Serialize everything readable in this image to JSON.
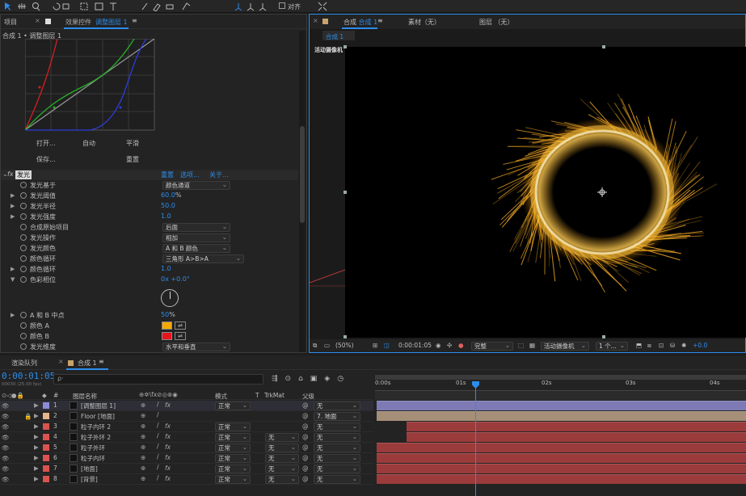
{
  "toolbar": {
    "align_label": "对齐"
  },
  "left_panel": {
    "tabs": [
      "项目",
      "效果控件",
      "调整图层 1"
    ],
    "tab_prefix": "效果控件",
    "tab_active": "调整图层 1",
    "breadcrumb": "合成 1 • 调整图层 1",
    "curve_buttons": {
      "open": "打开...",
      "auto": "自动",
      "smooth": "平滑",
      "save": "保存...",
      "reset": "重置"
    },
    "effect": {
      "fx": "fx",
      "name": "发光",
      "reset": "重置",
      "options": "选项...",
      "about": "关于..."
    },
    "props": [
      {
        "name": "发光基于",
        "dd": "颜色通道"
      },
      {
        "name": "发光阈值",
        "val": "60.0",
        "unit": "%"
      },
      {
        "name": "发光半径",
        "val": "50.0"
      },
      {
        "name": "发光强度",
        "val": "1.0"
      },
      {
        "name": "合成原始项目",
        "dd": "后面"
      },
      {
        "name": "发光操作",
        "dd": "相加"
      },
      {
        "name": "发光颜色",
        "dd": "A 和 B 颜色"
      },
      {
        "name": "颜色循环",
        "dd": "三角形 A>B>A"
      },
      {
        "name": "颜色循环",
        "val": "1.0"
      },
      {
        "name": "色彩相位",
        "val": "0x +0.0°"
      }
    ],
    "props2": [
      {
        "name": "A 和 B 中点",
        "val": "50",
        "unit": "%"
      },
      {
        "name": "颜色 A",
        "color": "#f5a800"
      },
      {
        "name": "颜色 B",
        "color": "#e8141c"
      },
      {
        "name": "发光维度",
        "dd": "水平和垂直"
      }
    ]
  },
  "viewer": {
    "tabs": [
      {
        "label": "合成",
        "active": "合成 1"
      },
      {
        "label": "素材（无）"
      },
      {
        "label": "图层 （无）"
      }
    ],
    "subtab": "合成 1",
    "camera_label": "活动摄像机",
    "bottom": {
      "zoom": "(50%)",
      "time": "0:00:01:05",
      "quality": "完整",
      "camera": "活动摄像机",
      "views": "1 个...",
      "exposure": "+0.0"
    }
  },
  "timeline": {
    "tabs": [
      "渲染队列",
      "合成 1"
    ],
    "timecode": "0:00:01:05",
    "frames": "00030 (25.00 fps)",
    "search_placeholder": "ρ·",
    "headers": {
      "name": "图层名称",
      "mode": "模式",
      "t": "T",
      "trkmat": "TrkMat",
      "parent": "父级"
    },
    "ruler": [
      "0:00s",
      "01s",
      "02s",
      "03s",
      "04s"
    ],
    "layers": [
      {
        "num": "1",
        "name": "[调整图层 1]",
        "label": "#8b8bd8",
        "mode": "正常",
        "parent": "无",
        "track": "#7d7ab6",
        "start": 0.0
      },
      {
        "num": "2",
        "name": "Floor [地面]",
        "label": "#e5b48c",
        "mode": "",
        "parent": "7. 地面",
        "track": "#a58f78",
        "start": 0.0
      },
      {
        "num": "3",
        "name": "粒子内环 2",
        "label": "#d9534f",
        "mode": "正常",
        "parent": "无",
        "track": "#9b3b3b",
        "start": 0.08
      },
      {
        "num": "4",
        "name": "粒子外环 2",
        "label": "#d9534f",
        "mode": "正常",
        "trk": "无",
        "parent": "无",
        "track": "#9b3b3b",
        "start": 0.08
      },
      {
        "num": "5",
        "name": "粒子外环",
        "label": "#d9534f",
        "mode": "正常",
        "trk": "无",
        "parent": "无",
        "track": "#9b3b3b",
        "start": 0.0
      },
      {
        "num": "6",
        "name": "粒子内环",
        "label": "#d9534f",
        "mode": "正常",
        "trk": "无",
        "parent": "无",
        "track": "#9b3b3b",
        "start": 0.0
      },
      {
        "num": "7",
        "name": "[地面]",
        "label": "#d9534f",
        "mode": "正常",
        "trk": "无",
        "parent": "无",
        "track": "#9b3b3b",
        "start": 0.0
      },
      {
        "num": "8",
        "name": "[背景]",
        "label": "#d9534f",
        "mode": "正常",
        "trk": "无",
        "parent": "无",
        "track": "#9b3b3b",
        "start": 0.0
      }
    ],
    "playhead_fraction": 0.27
  },
  "colors": {
    "accent": "#2d8ceb",
    "glow": "#ffb326"
  }
}
